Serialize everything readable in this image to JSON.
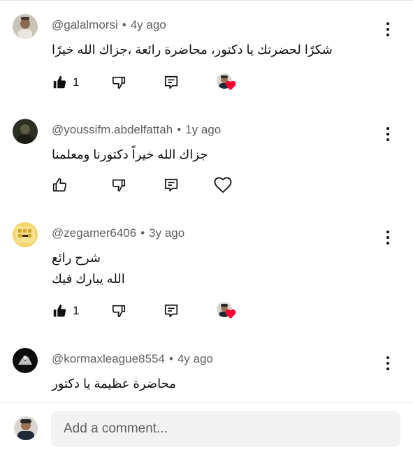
{
  "comments": [
    {
      "author": "@galalmorsi",
      "time": "4y ago",
      "lines": [
        "شكرًا لحضرتك يا دكتور، محاضرة رائعة ،جزاك الله خيرًا"
      ],
      "likes": "1",
      "liked": true,
      "creator_hearted": true
    },
    {
      "author": "@youssifm.abdelfattah",
      "time": "1y ago",
      "lines": [
        "جزاك الله خيراً دكتورنا ومعلمنا"
      ],
      "likes": "",
      "liked": false,
      "creator_hearted": false
    },
    {
      "author": "@zegamer6406",
      "time": "3y ago",
      "lines": [
        "شرح رائع",
        "الله يبارك فيك"
      ],
      "likes": "1",
      "liked": true,
      "creator_hearted": true
    },
    {
      "author": "@kormaxleague8554",
      "time": "4y ago",
      "lines": [
        "محاضرة عظيمة يا دكتور"
      ]
    }
  ],
  "separator": "•",
  "composer": {
    "placeholder": "Add a comment..."
  },
  "icons": {
    "like": "thumbs-up-icon",
    "dislike": "thumbs-down-icon",
    "reply": "reply-icon",
    "heart": "heart-icon",
    "more": "more-vert-icon"
  },
  "colors": {
    "heart": "#ff0033",
    "text": "#0f0f0f",
    "muted": "#606060",
    "composer_bg": "#f2f2f2"
  }
}
